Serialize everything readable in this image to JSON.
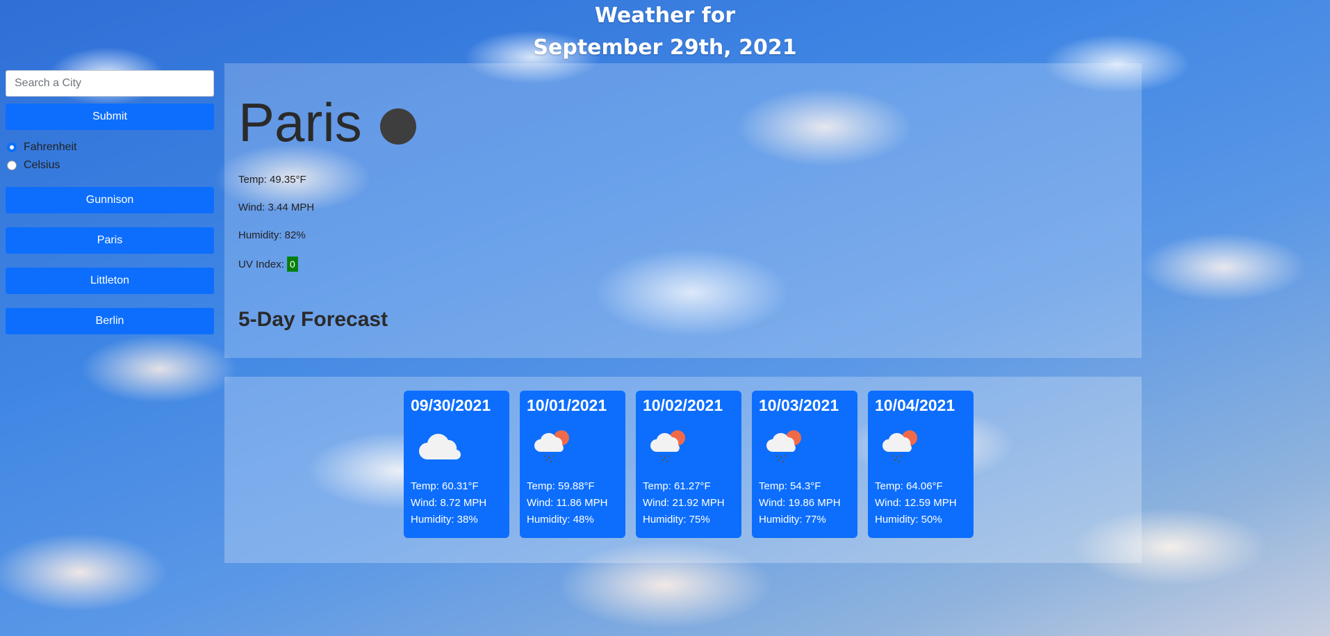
{
  "header": {
    "title_line1": "Weather for",
    "title_line2": "September 29th, 2021"
  },
  "sidebar": {
    "search_placeholder": "Search a City",
    "search_value": "",
    "submit_label": "Submit",
    "units": {
      "options": [
        "Fahrenheit",
        "Celsius"
      ],
      "selected": "Fahrenheit"
    },
    "cities": [
      "Gunnison",
      "Paris",
      "Littleton",
      "Berlin"
    ]
  },
  "current": {
    "city": "Paris",
    "icon": "dark-circle-icon",
    "temp": "Temp: 49.35°F",
    "wind": "Wind: 3.44 MPH",
    "humidity": "Humidity: 82%",
    "uv_label": "UV Index:",
    "uv_value": "0",
    "uv_color": "#0a7d0a"
  },
  "forecast": {
    "heading": "5-Day Forecast",
    "days": [
      {
        "date": "09/30/2021",
        "icon": "cloud-icon",
        "temp": "Temp: 60.31°F",
        "wind": "Wind: 8.72 MPH",
        "humidity": "Humidity: 38%"
      },
      {
        "date": "10/01/2021",
        "icon": "rain-sun-cloud-icon",
        "temp": "Temp: 59.88°F",
        "wind": "Wind: 11.86 MPH",
        "humidity": "Humidity: 48%"
      },
      {
        "date": "10/02/2021",
        "icon": "rain-sun-cloud-icon",
        "temp": "Temp: 61.27°F",
        "wind": "Wind: 21.92 MPH",
        "humidity": "Humidity: 75%"
      },
      {
        "date": "10/03/2021",
        "icon": "rain-sun-cloud-icon",
        "temp": "Temp: 54.3°F",
        "wind": "Wind: 19.86 MPH",
        "humidity": "Humidity: 77%"
      },
      {
        "date": "10/04/2021",
        "icon": "rain-sun-cloud-icon",
        "temp": "Temp: 64.06°F",
        "wind": "Wind: 12.59 MPH",
        "humidity": "Humidity: 50%"
      }
    ]
  },
  "colors": {
    "primary": "#0d6efd",
    "uv_good": "#0a7d0a"
  }
}
